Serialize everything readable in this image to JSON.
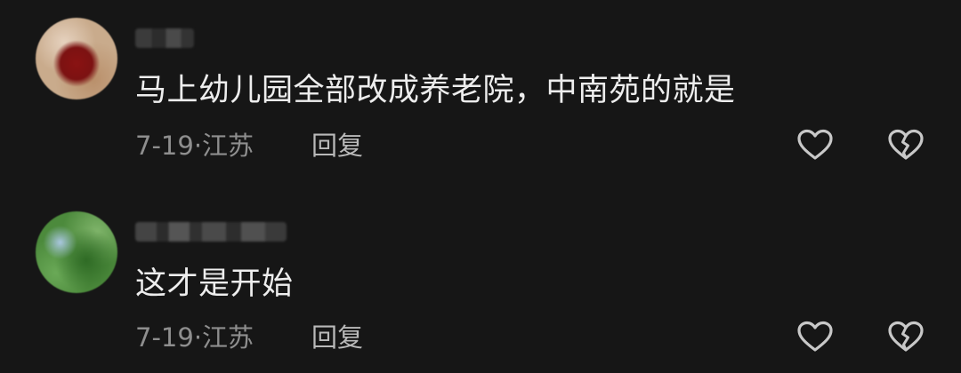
{
  "comments": [
    {
      "avatar": "user-avatar",
      "text": "马上幼儿园全部改成养老院，中南苑的就是",
      "date": "7-19",
      "separator": "·",
      "location": "江苏",
      "reply_label": "回复",
      "like_icon": "heart-icon",
      "dislike_icon": "broken-heart-icon"
    },
    {
      "avatar": "user-avatar",
      "text": "这才是开始",
      "date": "7-19",
      "separator": "·",
      "location": "江苏",
      "reply_label": "回复",
      "like_icon": "heart-icon",
      "dislike_icon": "broken-heart-icon"
    }
  ],
  "colors": {
    "background": "#161616",
    "text": "#ededed",
    "meta": "#8e8e8e",
    "icon": "#c8c8c8"
  }
}
